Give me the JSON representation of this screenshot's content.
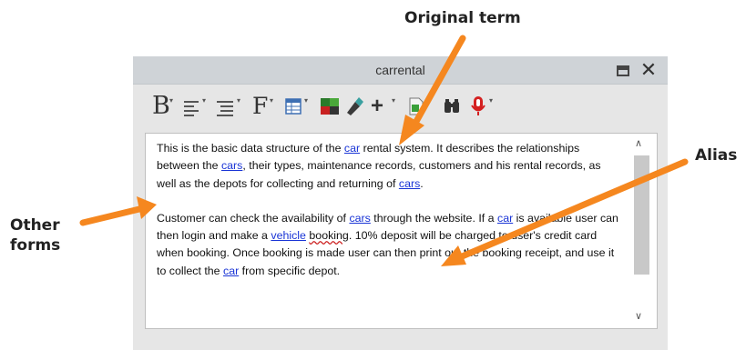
{
  "callouts": {
    "original_term": "Original term",
    "alias": "Alias",
    "other_forms": "Other forms"
  },
  "window": {
    "title": "carrental"
  },
  "toolbar": {
    "bold_label": "B",
    "font_label": "F",
    "icons": [
      "bold-icon",
      "align-icon",
      "list-icon",
      "font-icon",
      "table-icon",
      "color-icon",
      "brush-icon",
      "add-icon",
      "document-icon",
      "find-icon",
      "record-icon"
    ]
  },
  "content": {
    "p1": [
      {
        "t": "This is the basic data structure of the "
      },
      {
        "t": "car",
        "link": true
      },
      {
        "t": " rental system. It describes the relationships between the "
      },
      {
        "t": "cars",
        "link": true
      },
      {
        "t": ", their types, maintenance records, customers and his rental records, as well as the depots for collecting and returning of "
      },
      {
        "t": "cars",
        "link": true
      },
      {
        "t": "."
      }
    ],
    "p2": [
      {
        "t": "Customer can check the availability of "
      },
      {
        "t": "cars",
        "link": true
      },
      {
        "t": " through the website. If a "
      },
      {
        "t": "car",
        "link": true
      },
      {
        "t": " is available user can then login and make a "
      },
      {
        "t": "vehicle",
        "link": true
      },
      {
        "t": " "
      },
      {
        "t": "booking",
        "squig": true
      },
      {
        "t": ". 10% deposit will be charged to user's credit card when booking. Once booking is made user can then print out the booking receipt, and use it to collect the "
      },
      {
        "t": "car",
        "link": true
      },
      {
        "t": " from specific depot."
      }
    ]
  },
  "colors": {
    "arrow": "#f5871f",
    "link": "#1a35d6",
    "titlebar": "#cfd3d7"
  }
}
